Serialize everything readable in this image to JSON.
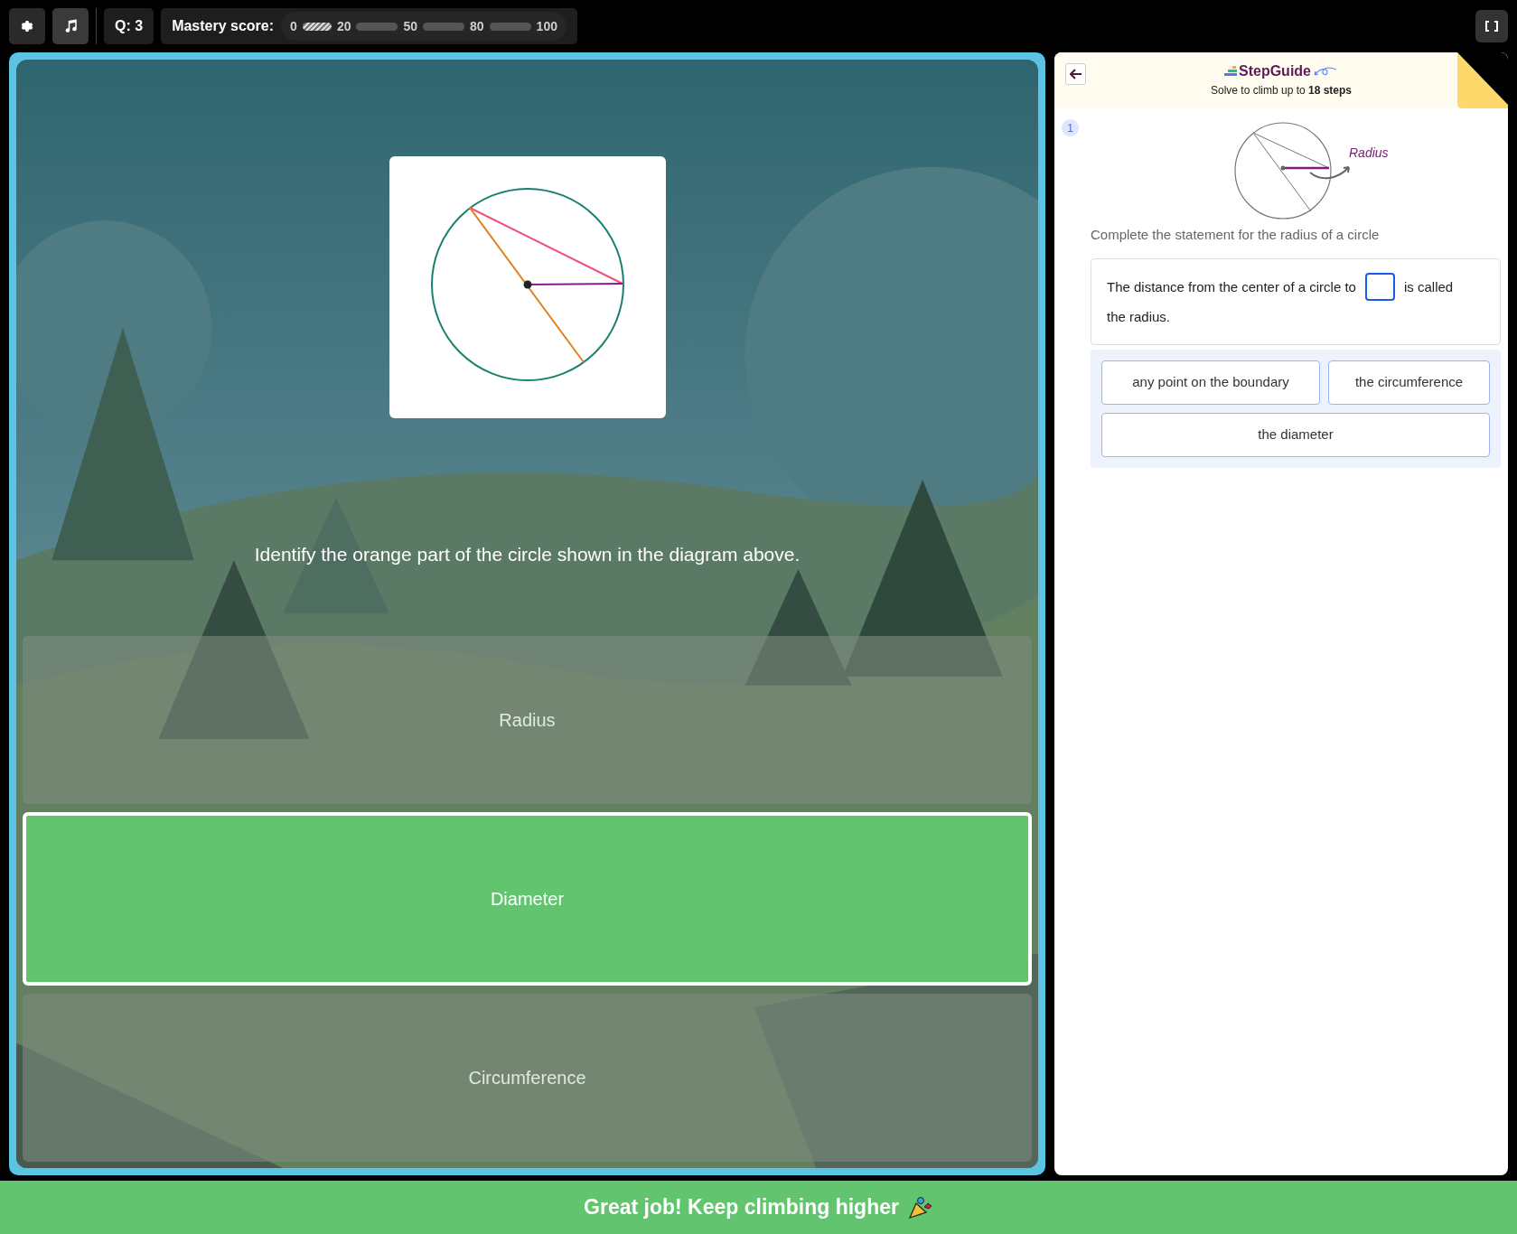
{
  "toolbar": {
    "question": "Q: 3",
    "mastery": {
      "label": "Mastery score:",
      "ticks": [
        "0",
        "20",
        "50",
        "80",
        "100"
      ],
      "segments": [
        {
          "current": true
        },
        {
          "current": false
        },
        {
          "current": false
        },
        {
          "current": false
        }
      ]
    }
  },
  "question": {
    "text": "Identify the orange part of the circle shown in the diagram above.",
    "options": [
      {
        "label": "Radius",
        "selected": false
      },
      {
        "label": "Diameter",
        "selected": true
      },
      {
        "label": "Circumference",
        "selected": false
      }
    ]
  },
  "guide": {
    "logo": "StepGuide",
    "subtitle": "Solve to climb up to **18 steps**",
    "step": "1",
    "diagram_label": "Radius",
    "prompt": "Complete the statement for the radius of a circle",
    "statement_before": "The distance from the center of a circle to",
    "statement_after": "is called",
    "statement_end": "the radius.",
    "choices": [
      "any point on the boundary",
      "the circumference",
      "the diameter"
    ]
  },
  "banner": "Great job! Keep climbing higher"
}
